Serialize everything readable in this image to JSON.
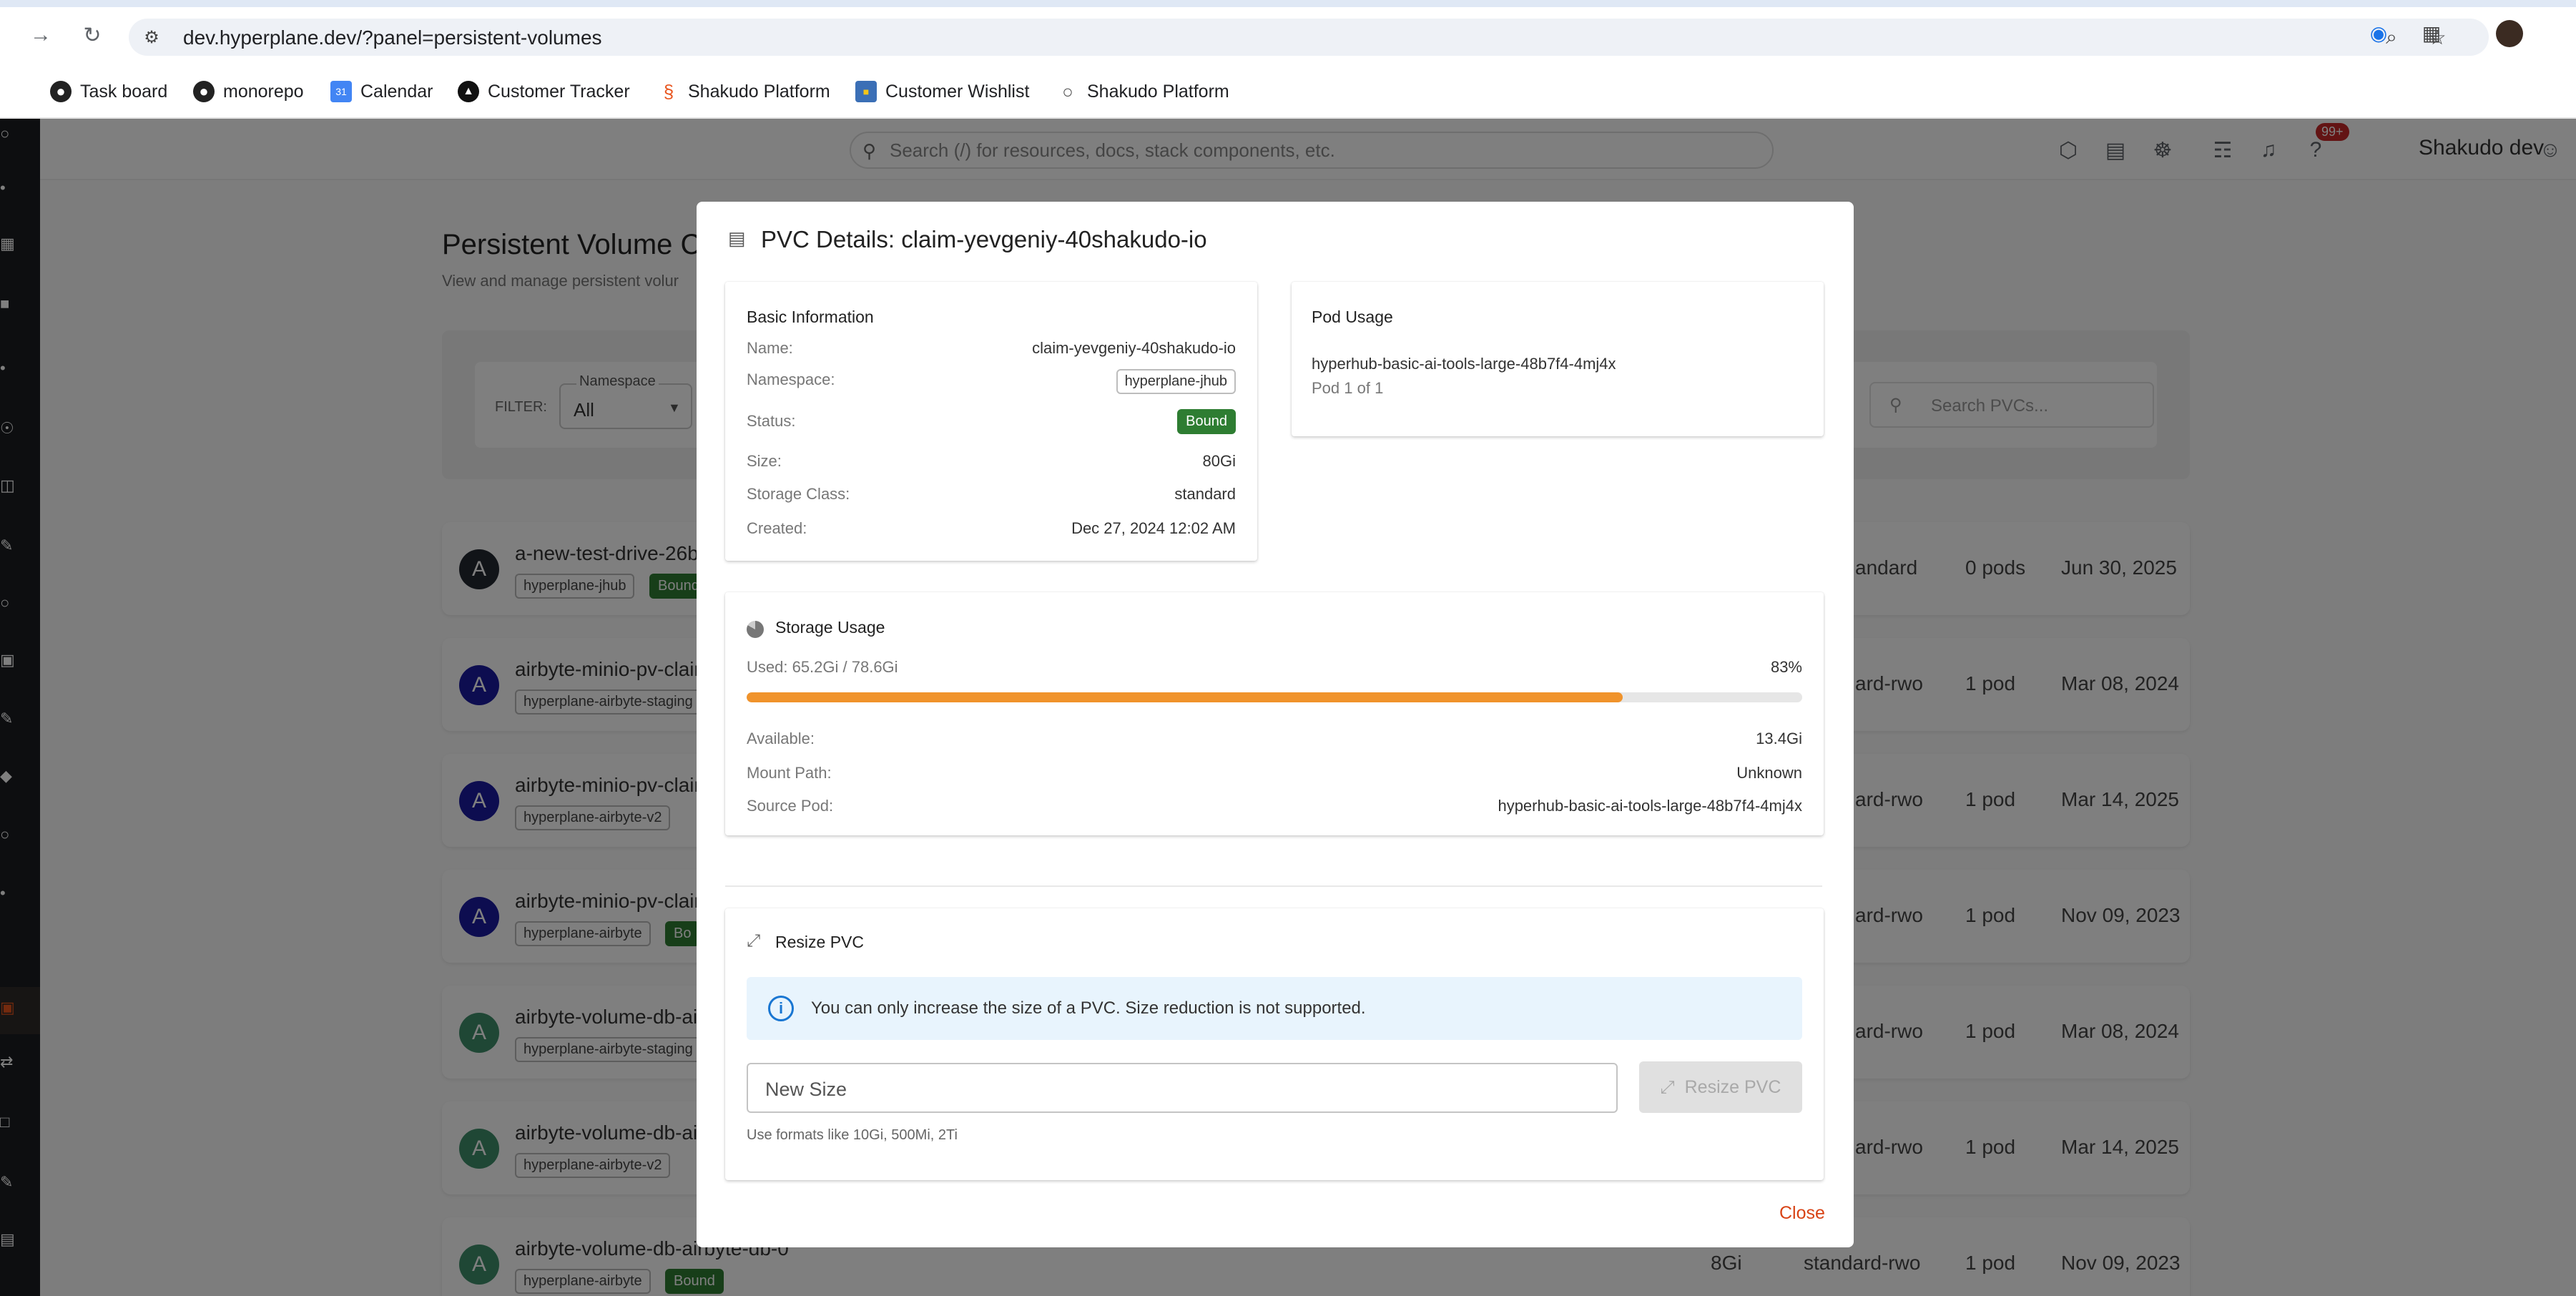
{
  "browser": {
    "url": "dev.hyperplane.dev/?panel=persistent-volumes",
    "bookmarks": [
      {
        "label": "Task board",
        "icon": "github-icon"
      },
      {
        "label": "monorepo",
        "icon": "github-icon"
      },
      {
        "label": "Calendar",
        "icon": "calendar-icon"
      },
      {
        "label": "Customer Tracker",
        "icon": "tracker-icon"
      },
      {
        "label": "Shakudo Platform",
        "icon": "shakudo-icon"
      },
      {
        "label": "Customer Wishlist",
        "icon": "wishlist-icon"
      },
      {
        "label": "Shakudo Platform",
        "icon": "globe-icon"
      }
    ]
  },
  "app": {
    "search_placeholder": "Search (/) for resources, docs, stack components, etc.",
    "notification_count": "99+",
    "user_name": "Shakudo dev",
    "page_title": "Persistent Volume C",
    "page_subtitle": "View and manage persistent volur",
    "filter_label": "FILTER:",
    "namespace_label": "Namespace",
    "namespace_value": "All",
    "pvc_search_placeholder": "Search PVCs...",
    "rows": [
      {
        "avatar": "A",
        "avatar_color": "#222831",
        "name": "a-new-test-drive-26b",
        "namespace": "hyperplane-jhub",
        "status": "Bound",
        "storage_class": "andard",
        "pods": "0 pods",
        "date": "Jun 30, 2025"
      },
      {
        "avatar": "A",
        "avatar_color": "#1a1aa0",
        "name": "airbyte-minio-pv-clair",
        "namespace": "hyperplane-airbyte-staging",
        "status": "",
        "storage_class": "ard-rwo",
        "pods": "1 pod",
        "date": "Mar 08, 2024"
      },
      {
        "avatar": "A",
        "avatar_color": "#1a1aa0",
        "name": "airbyte-minio-pv-clair",
        "namespace": "hyperplane-airbyte-v2",
        "status": "",
        "storage_class": "ard-rwo",
        "pods": "1 pod",
        "date": "Mar 14, 2025"
      },
      {
        "avatar": "A",
        "avatar_color": "#1a1aa0",
        "name": "airbyte-minio-pv-clair",
        "namespace": "hyperplane-airbyte",
        "status": "Bo",
        "storage_class": "ard-rwo",
        "pods": "1 pod",
        "date": "Nov 09, 2023"
      },
      {
        "avatar": "A",
        "avatar_color": "#3f8f6a",
        "name": "airbyte-volume-db-air",
        "namespace": "hyperplane-airbyte-staging",
        "status": "",
        "storage_class": "ard-rwo",
        "pods": "1 pod",
        "date": "Mar 08, 2024"
      },
      {
        "avatar": "A",
        "avatar_color": "#3f8f6a",
        "name": "airbyte-volume-db-air",
        "namespace": "hyperplane-airbyte-v2",
        "status": "",
        "storage_class": "ard-rwo",
        "pods": "1 pod",
        "date": "Mar 14, 2025"
      },
      {
        "avatar": "A",
        "avatar_color": "#3f8f6a",
        "name": "airbyte-volume-db-airbyte-db-0",
        "namespace": "hyperplane-airbyte",
        "status": "Bound",
        "size": "8Gi",
        "storage_class": "standard-rwo",
        "pods": "1 pod",
        "date": "Nov 09, 2023"
      }
    ]
  },
  "modal": {
    "title": "PVC Details: claim-yevgeniy-40shakudo-io",
    "basic": {
      "heading": "Basic Information",
      "name_label": "Name:",
      "name_value": "claim-yevgeniy-40shakudo-io",
      "namespace_label": "Namespace:",
      "namespace_value": "hyperplane-jhub",
      "status_label": "Status:",
      "status_value": "Bound",
      "size_label": "Size:",
      "size_value": "80Gi",
      "storage_class_label": "Storage Class:",
      "storage_class_value": "standard",
      "created_label": "Created:",
      "created_value": "Dec 27, 2024 12:02 AM"
    },
    "pod_usage": {
      "heading": "Pod Usage",
      "pod_name": "hyperhub-basic-ai-tools-large-48b7f4-4mj4x",
      "pod_count": "Pod 1 of 1"
    },
    "storage": {
      "heading": "Storage Usage",
      "used_text": "Used: 65.2Gi / 78.6Gi",
      "percent_text": "83%",
      "percent": 83,
      "available_label": "Available:",
      "available_value": "13.4Gi",
      "mount_label": "Mount Path:",
      "mount_value": "Unknown",
      "source_label": "Source Pod:",
      "source_value": "hyperhub-basic-ai-tools-large-48b7f4-4mj4x"
    },
    "resize": {
      "heading": "Resize PVC",
      "info": "You can only increase the size of a PVC. Size reduction is not supported.",
      "input_placeholder": "New Size",
      "button_label": "Resize PVC",
      "hint": "Use formats like 10Gi, 500Mi, 2Ti"
    },
    "close_label": "Close"
  },
  "colors": {
    "accent_orange": "#f0932b",
    "status_green": "#2e7d32",
    "close_red": "#d84315",
    "info_blue": "#1976d2"
  }
}
